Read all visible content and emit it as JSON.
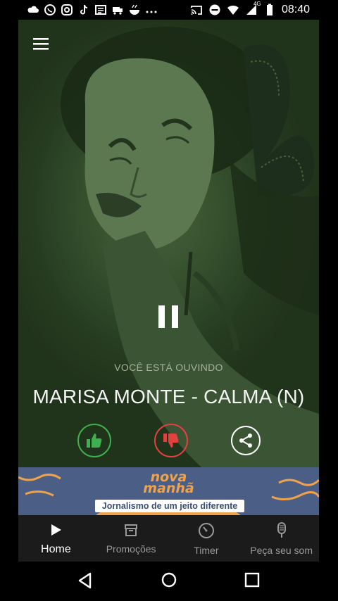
{
  "status_bar": {
    "time": "08:40",
    "network_label": "4G",
    "icons": [
      "cloud-icon",
      "whatsapp-icon",
      "instagram-icon",
      "tiktok-icon",
      "news-icon",
      "delivery-icon",
      "food-icon",
      "more-dots-icon",
      "cast-icon",
      "dnd-icon",
      "wifi-icon",
      "signal-icon",
      "battery-icon"
    ]
  },
  "player": {
    "now_playing_label": "VOCÊ ESTÁ OUVINDO",
    "song_title": "MARISA MONTE - CALMA (N)",
    "state": "playing"
  },
  "banner": {
    "logo_line1": "nova",
    "logo_line2": "manhã",
    "tagline": "Jornalismo de um jeito diferente"
  },
  "bottom_nav": {
    "items": [
      {
        "label": "Home",
        "icon": "play-icon",
        "active": true
      },
      {
        "label": "Promoções",
        "icon": "gift-box-icon",
        "active": false
      },
      {
        "label": "Timer",
        "icon": "timer-icon",
        "active": false
      },
      {
        "label": "Peça seu som",
        "icon": "microphone-icon",
        "active": false
      }
    ]
  },
  "colors": {
    "like": "#3fb04f",
    "dislike": "#e2413f",
    "banner_bg": "#4b5f86",
    "banner_logo": "#f0a24a",
    "nav_bg": "#1b1b1b"
  }
}
